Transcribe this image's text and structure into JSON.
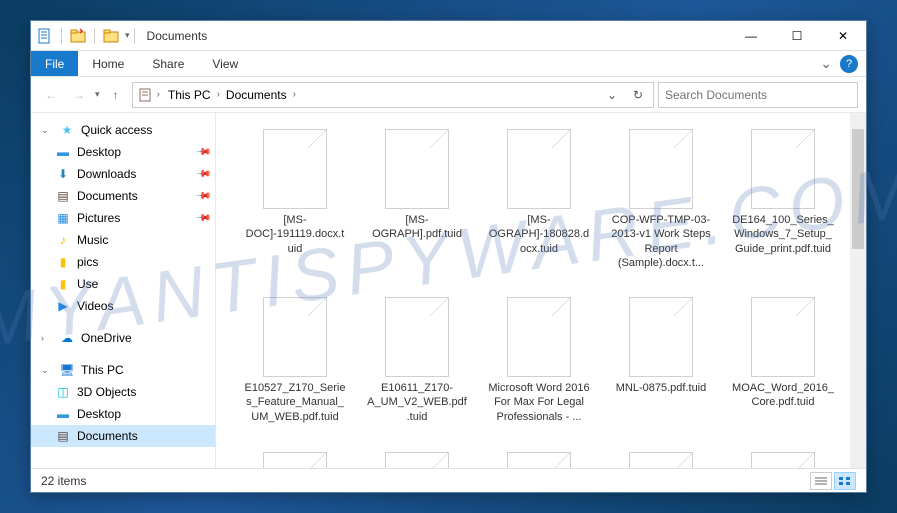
{
  "window": {
    "title": "Documents",
    "minimize": "—",
    "maximize": "☐",
    "close": "✕"
  },
  "tabs": {
    "file": "File",
    "home": "Home",
    "share": "Share",
    "view": "View"
  },
  "breadcrumb": {
    "root": "This PC",
    "current": "Documents"
  },
  "search": {
    "placeholder": "Search Documents"
  },
  "nav": {
    "quick_access": "Quick access",
    "desktop": "Desktop",
    "downloads": "Downloads",
    "documents": "Documents",
    "pictures": "Pictures",
    "music": "Music",
    "pics": "pics",
    "use": "Use",
    "videos": "Videos",
    "onedrive": "OneDrive",
    "this_pc": "This PC",
    "3d_objects": "3D Objects",
    "desktop2": "Desktop",
    "documents2": "Documents"
  },
  "files": [
    {
      "name": "[MS-DOC]-191119.docx.tuid"
    },
    {
      "name": "[MS-OGRAPH].pdf.tuid"
    },
    {
      "name": "[MS-OGRAPH]-180828.docx.tuid"
    },
    {
      "name": "COP-WFP-TMP-03-2013-v1 Work Steps Report (Sample).docx.t..."
    },
    {
      "name": "DE164_100_Series_Windows_7_Setup_Guide_print.pdf.tuid"
    },
    {
      "name": "E10527_Z170_Series_Feature_Manual_UM_WEB.pdf.tuid"
    },
    {
      "name": "E10611_Z170-A_UM_V2_WEB.pdf.tuid"
    },
    {
      "name": "Microsoft Word 2016 For Max For Legal Professionals - ..."
    },
    {
      "name": "MNL-0875.pdf.tuid"
    },
    {
      "name": "MOAC_Word_2016_Core.pdf.tuid"
    }
  ],
  "statusbar": {
    "count": "22 items"
  }
}
